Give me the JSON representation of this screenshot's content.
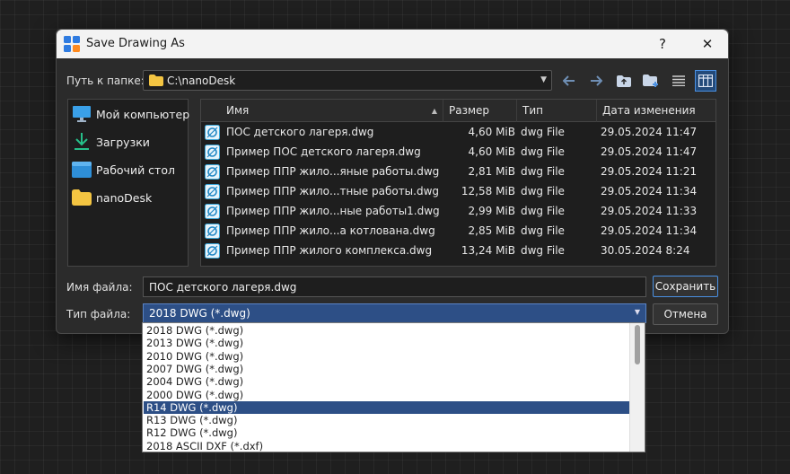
{
  "window": {
    "title": "Save Drawing As",
    "help": "?",
    "close": "✕"
  },
  "location": {
    "label": "Путь к папке:",
    "value": "C:\\nanoDesk"
  },
  "places": [
    {
      "label": "Мой компьютер",
      "icon": "monitor-icon"
    },
    {
      "label": "Загрузки",
      "icon": "download-icon"
    },
    {
      "label": "Рабочий стол",
      "icon": "desktop-icon"
    },
    {
      "label": "nanoDesk",
      "icon": "folder-icon"
    }
  ],
  "columns": {
    "name": "Имя",
    "size": "Размер",
    "type": "Тип",
    "date": "Дата изменения"
  },
  "files": [
    {
      "name": "ПОС детского лагеря.dwg",
      "size": "4,60 MiB",
      "type": "dwg File",
      "date": "29.05.2024 11:47"
    },
    {
      "name": "Пример ПОС детского лагеря.dwg",
      "size": "4,60 MiB",
      "type": "dwg File",
      "date": "29.05.2024 11:47"
    },
    {
      "name": "Пример ППР жило...яные работы.dwg",
      "size": "2,81 MiB",
      "type": "dwg File",
      "date": "29.05.2024 11:21"
    },
    {
      "name": "Пример ППР жило...тные работы.dwg",
      "size": "12,58 MiB",
      "type": "dwg File",
      "date": "29.05.2024 11:34"
    },
    {
      "name": "Пример ППР жило...ные работы1.dwg",
      "size": "2,99 MiB",
      "type": "dwg File",
      "date": "29.05.2024 11:33"
    },
    {
      "name": "Пример ППР жило...а котлована.dwg",
      "size": "2,85 MiB",
      "type": "dwg File",
      "date": "29.05.2024 11:34"
    },
    {
      "name": "Пример ППР жилого комплекса.dwg",
      "size": "13,24 MiB",
      "type": "dwg File",
      "date": "30.05.2024 8:24"
    }
  ],
  "filename": {
    "label": "Имя файла:",
    "value": "ПОС детского лагеря.dwg"
  },
  "filetype": {
    "label": "Тип файла:",
    "value": "2018 DWG (*.dwg)",
    "options": [
      "2018 DWG (*.dwg)",
      "2013 DWG (*.dwg)",
      "2010 DWG (*.dwg)",
      "2007 DWG (*.dwg)",
      "2004 DWG (*.dwg)",
      "2000 DWG (*.dwg)",
      "R14 DWG (*.dwg)",
      "R13 DWG (*.dwg)",
      "R12 DWG (*.dwg)",
      "2018 ASCII DXF (*.dxf)"
    ],
    "highlighted_option": "R14 DWG (*.dwg)"
  },
  "buttons": {
    "save": "Сохранить",
    "cancel": "Отмена"
  },
  "colors": {
    "accent": "#4a90e2",
    "selection": "#2d4f86",
    "folder": "#f4c542"
  }
}
